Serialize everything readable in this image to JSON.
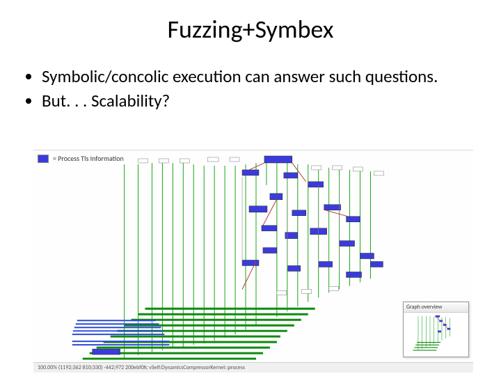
{
  "title": "Fuzzing+Symbex",
  "bullets": [
    "Symbolic/concolic execution can answer such questions.",
    "But. . . Scalability?"
  ],
  "legend": {
    "label": "= Process Tls Information"
  },
  "overview": {
    "title": "Graph overview"
  },
  "statusbar": "100.00%   (1192;362 810;330)   -442;972   200ebf0fc   vSelf:DynamicsCompressorKernel::process"
}
